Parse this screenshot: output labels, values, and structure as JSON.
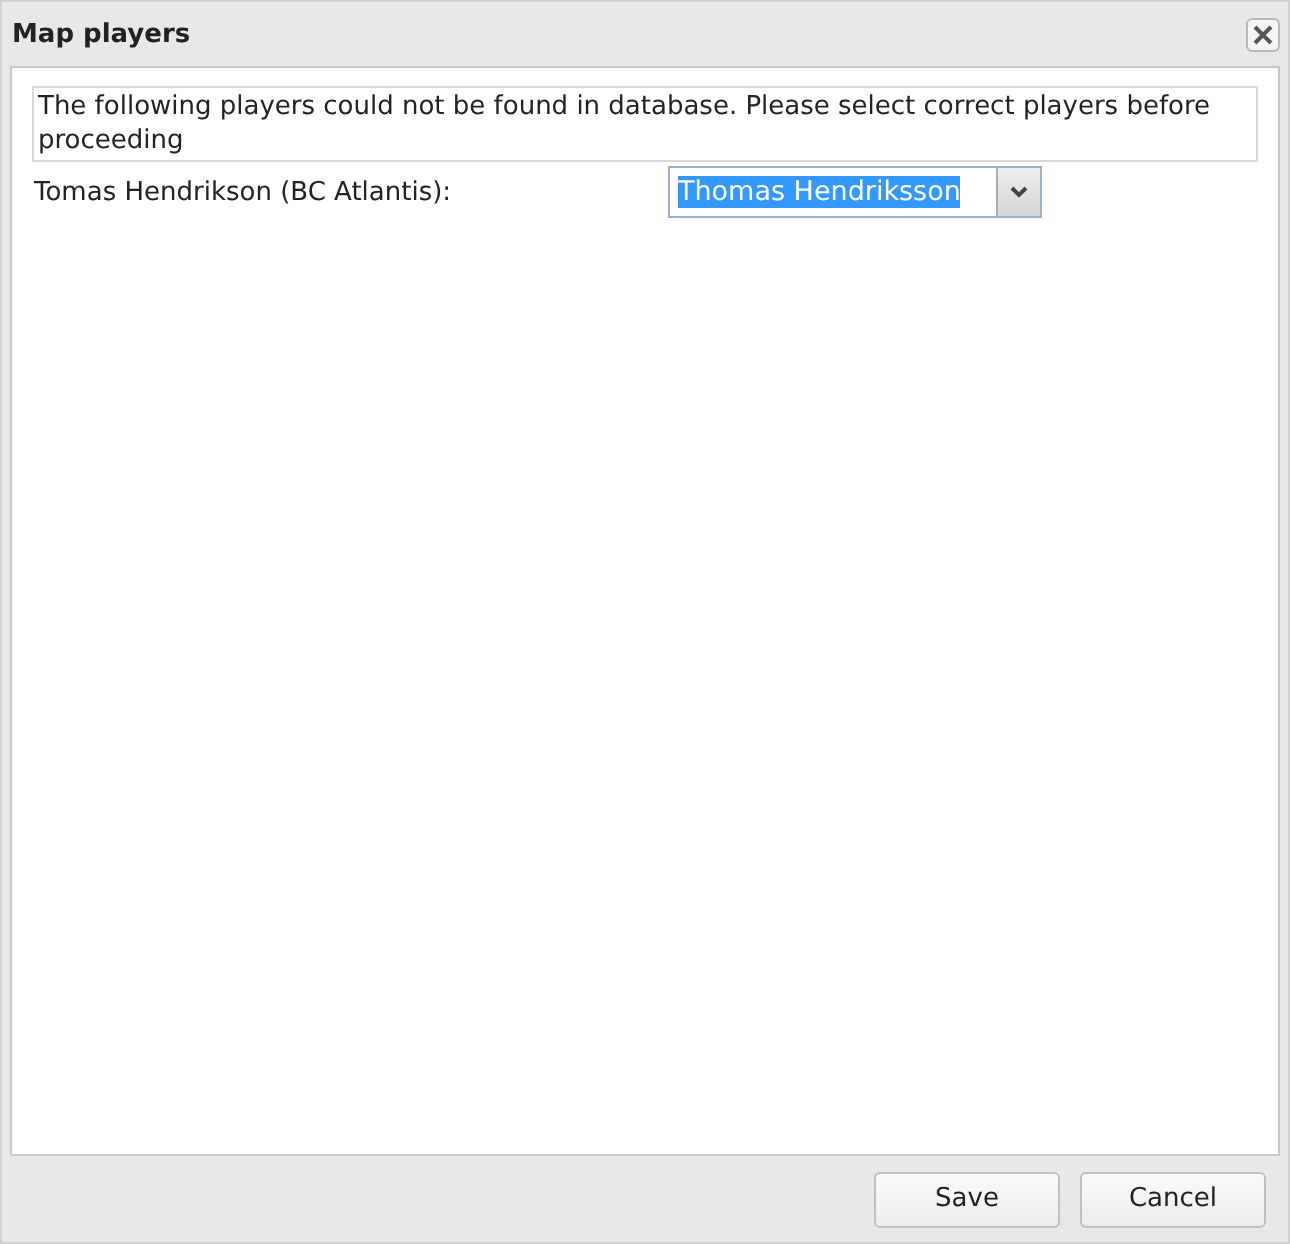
{
  "window": {
    "title": "Map players"
  },
  "message": "The following players could not be found in database. Please select correct players before proceeding",
  "mappings": [
    {
      "label": "Tomas Hendrikson (BC Atlantis):",
      "value": "Thomas Hendriksson",
      "highlighted": true
    }
  ],
  "buttons": [
    "Save",
    "Cancel"
  ]
}
